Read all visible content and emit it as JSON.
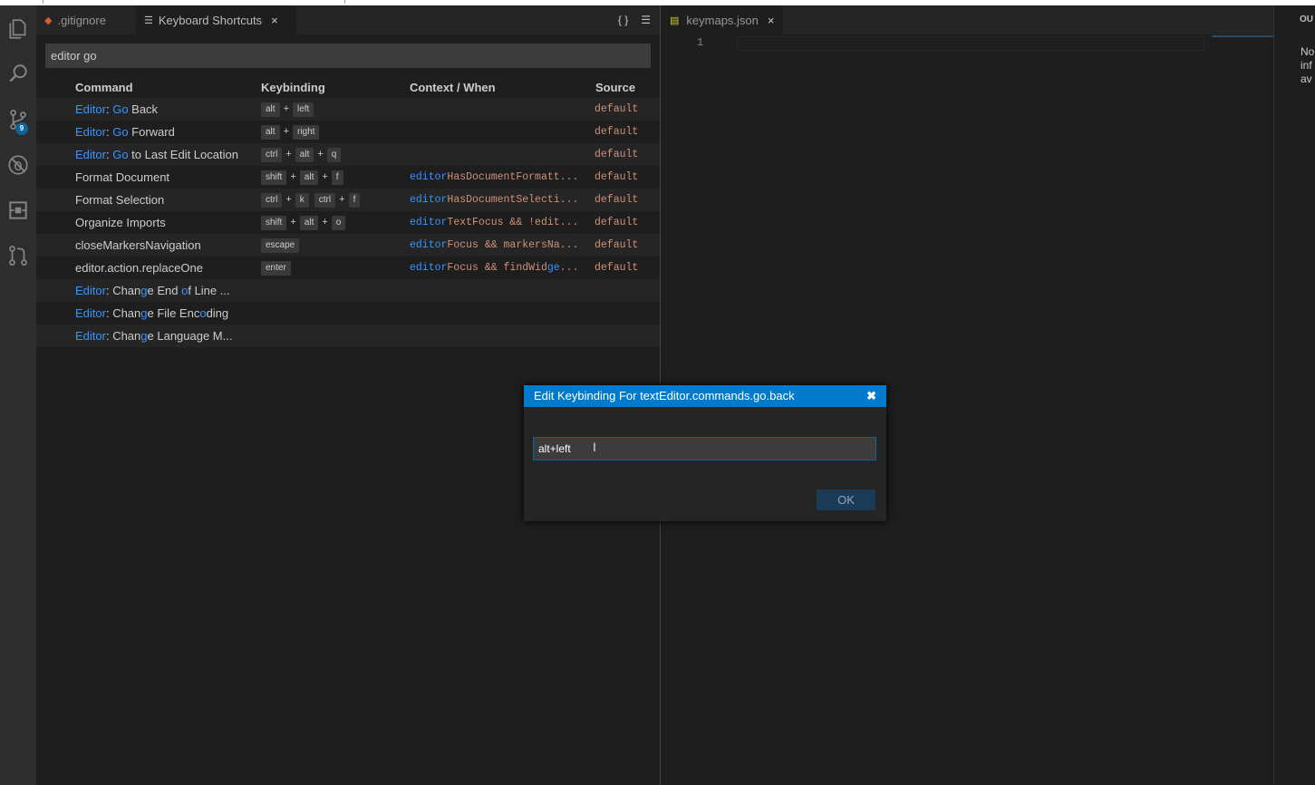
{
  "tabs": {
    "gitignore": ".gitignore",
    "keyboard_shortcuts": "Keyboard Shortcuts",
    "keymaps": "keymaps.json",
    "close_glyph": "×",
    "actions": {
      "open_json": "{ }",
      "clear": "☰"
    }
  },
  "activity_badge": "9",
  "search": {
    "value": "editor go"
  },
  "columns": {
    "command": "Command",
    "keybinding": "Keybinding",
    "context": "Context / When",
    "source": "Source"
  },
  "rows": [
    {
      "cmd": [
        [
          "Editor",
          true
        ],
        [
          ": ",
          false
        ],
        [
          "Go",
          true
        ],
        [
          " Back",
          false
        ]
      ],
      "keys": [
        [
          "alt",
          "left"
        ]
      ],
      "ctx": [],
      "source": "default"
    },
    {
      "cmd": [
        [
          "Editor",
          true
        ],
        [
          ": ",
          false
        ],
        [
          "Go",
          true
        ],
        [
          " Forward",
          false
        ]
      ],
      "keys": [
        [
          "alt",
          "right"
        ]
      ],
      "ctx": [],
      "source": "default"
    },
    {
      "cmd": [
        [
          "Editor",
          true
        ],
        [
          ": ",
          false
        ],
        [
          "Go",
          true
        ],
        [
          " to Last Edit Location",
          false
        ]
      ],
      "keys": [
        [
          "ctrl",
          "alt",
          "q"
        ]
      ],
      "ctx": [],
      "source": "default"
    },
    {
      "cmd": [
        [
          "Format Document",
          false
        ]
      ],
      "keys": [
        [
          "shift",
          "alt",
          "f"
        ]
      ],
      "ctx": [
        [
          "editor",
          true
        ],
        [
          "HasDocumentFormatt...",
          false
        ]
      ],
      "source": "default"
    },
    {
      "cmd": [
        [
          "Format Selection",
          false
        ]
      ],
      "keys": [
        [
          "ctrl",
          "k"
        ],
        [
          "ctrl",
          "f"
        ]
      ],
      "ctx": [
        [
          "editor",
          true
        ],
        [
          "HasDocumentSelecti...",
          false
        ]
      ],
      "source": "default"
    },
    {
      "cmd": [
        [
          "Organize Imports",
          false
        ]
      ],
      "keys": [
        [
          "shift",
          "alt",
          "o"
        ]
      ],
      "ctx": [
        [
          "editor",
          true
        ],
        [
          "TextFocus && !edit...",
          false
        ]
      ],
      "source": "default"
    },
    {
      "cmd": [
        [
          "closeMarkersNavigation",
          false
        ]
      ],
      "keys": [
        [
          "escape"
        ]
      ],
      "ctx": [
        [
          "editor",
          true
        ],
        [
          "Focus && markersNa...",
          false
        ]
      ],
      "source": "default"
    },
    {
      "cmd": [
        [
          "editor.action.replaceOne",
          false
        ]
      ],
      "keys": [
        [
          "enter"
        ]
      ],
      "ctx": [
        [
          "editor",
          true
        ],
        [
          "Focus && findWid",
          false
        ],
        [
          "ge",
          true
        ],
        [
          "...",
          false
        ]
      ],
      "source": "default"
    },
    {
      "cmd": [
        [
          "Editor",
          true
        ],
        [
          ": Chan",
          false
        ],
        [
          "g",
          true
        ],
        [
          "e End ",
          false
        ],
        [
          "o",
          true
        ],
        [
          "f Line ...",
          false
        ]
      ],
      "keys": [],
      "ctx": [],
      "source": ""
    },
    {
      "cmd": [
        [
          "Editor",
          true
        ],
        [
          ": Chan",
          false
        ],
        [
          "g",
          true
        ],
        [
          "e File Enc",
          false
        ],
        [
          "o",
          true
        ],
        [
          "ding",
          false
        ]
      ],
      "keys": [],
      "ctx": [],
      "source": ""
    },
    {
      "cmd": [
        [
          "Editor",
          true
        ],
        [
          ": Chan",
          false
        ],
        [
          "g",
          true
        ],
        [
          "e Language M...",
          false
        ]
      ],
      "keys": [],
      "ctx": [],
      "source": ""
    }
  ],
  "editor": {
    "line_number": "1"
  },
  "output": {
    "title": "OU",
    "message": "No\ninf\nav"
  },
  "dialog": {
    "title": "Edit Keybinding For textEditor.commands.go.back",
    "close": "✖",
    "value": "alt+left",
    "ok": "OK"
  },
  "colors": {
    "accent": "#007acc",
    "highlight": "#3794ff",
    "string": "#ce9178",
    "badge": "#0e639c"
  }
}
